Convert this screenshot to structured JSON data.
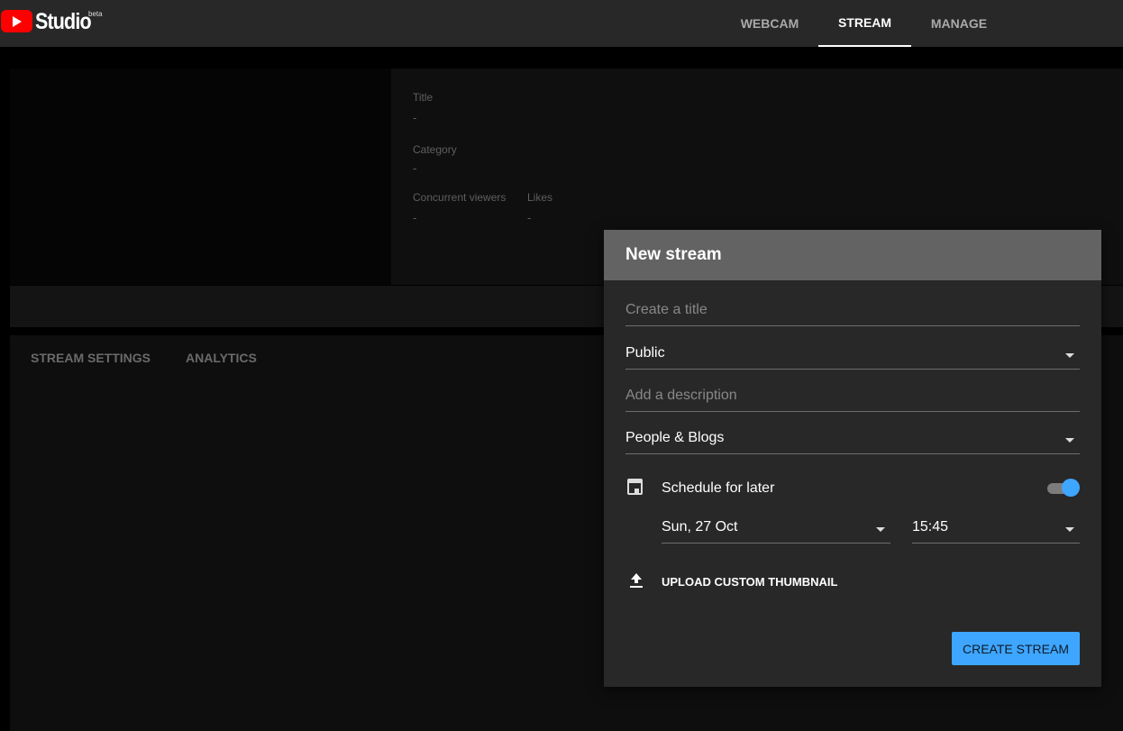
{
  "app": {
    "brand": "Studio",
    "badge": "beta"
  },
  "nav": [
    {
      "label": "WEBCAM",
      "active": false
    },
    {
      "label": "STREAM",
      "active": true
    },
    {
      "label": "MANAGE",
      "active": false
    }
  ],
  "info": {
    "title_label": "Title",
    "title_value": "-",
    "category_label": "Category",
    "category_value": "-",
    "viewers_label": "Concurrent viewers",
    "viewers_value": "-",
    "likes_label": "Likes",
    "likes_value": "-"
  },
  "tabs": [
    "STREAM SETTINGS",
    "ANALYTICS"
  ],
  "dialog": {
    "title": "New stream",
    "title_placeholder": "Create a title",
    "privacy": "Public",
    "description_placeholder": "Add a description",
    "category": "People & Blogs",
    "schedule_label": "Schedule for later",
    "schedule_enabled": true,
    "date": "Sun, 27 Oct",
    "time": "15:45",
    "upload_label": "UPLOAD CUSTOM THUMBNAIL",
    "create_label": "CREATE STREAM"
  },
  "colors": {
    "accent": "#3ea6ff",
    "brand_red": "#ff0000"
  }
}
